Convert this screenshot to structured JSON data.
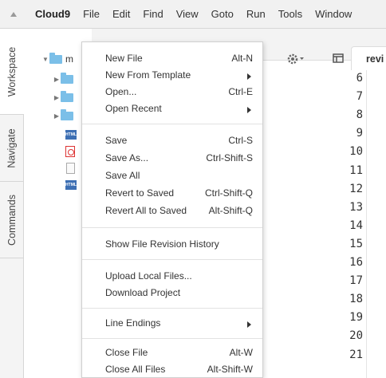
{
  "menubar": {
    "logo": "Cloud9",
    "items": [
      "File",
      "Edit",
      "Find",
      "View",
      "Goto",
      "Run",
      "Tools",
      "Window"
    ]
  },
  "side_tabs": {
    "workspace": "Workspace",
    "navigate": "Navigate",
    "commands": "Commands"
  },
  "tree": {
    "root_partial": "m",
    "html_icon_text": "HTML"
  },
  "editor": {
    "tab_label": "revi",
    "line_numbers": [
      "6",
      "7",
      "8",
      "9",
      "10",
      "11",
      "12",
      "13",
      "14",
      "15",
      "16",
      "17",
      "18",
      "19",
      "20",
      "21"
    ]
  },
  "file_menu": {
    "new_file": {
      "label": "New File",
      "shortcut": "Alt-N"
    },
    "new_from_template": {
      "label": "New From Template"
    },
    "open": {
      "label": "Open...",
      "shortcut": "Ctrl-E"
    },
    "open_recent": {
      "label": "Open Recent"
    },
    "save": {
      "label": "Save",
      "shortcut": "Ctrl-S"
    },
    "save_as": {
      "label": "Save As...",
      "shortcut": "Ctrl-Shift-S"
    },
    "save_all": {
      "label": "Save All"
    },
    "revert_to_saved": {
      "label": "Revert to Saved",
      "shortcut": "Ctrl-Shift-Q"
    },
    "revert_all_to_saved": {
      "label": "Revert All to Saved",
      "shortcut": "Alt-Shift-Q"
    },
    "show_revision_history": {
      "label": "Show File Revision History"
    },
    "upload_local_files": {
      "label": "Upload Local Files..."
    },
    "download_project": {
      "label": "Download Project"
    },
    "line_endings": {
      "label": "Line Endings"
    },
    "close_file": {
      "label": "Close File",
      "shortcut": "Alt-W"
    },
    "close_all_files": {
      "label": "Close All Files",
      "shortcut": "Alt-Shift-W"
    }
  },
  "colors": {
    "highlight": "#ffff33",
    "folder": "#7bbfe8"
  }
}
